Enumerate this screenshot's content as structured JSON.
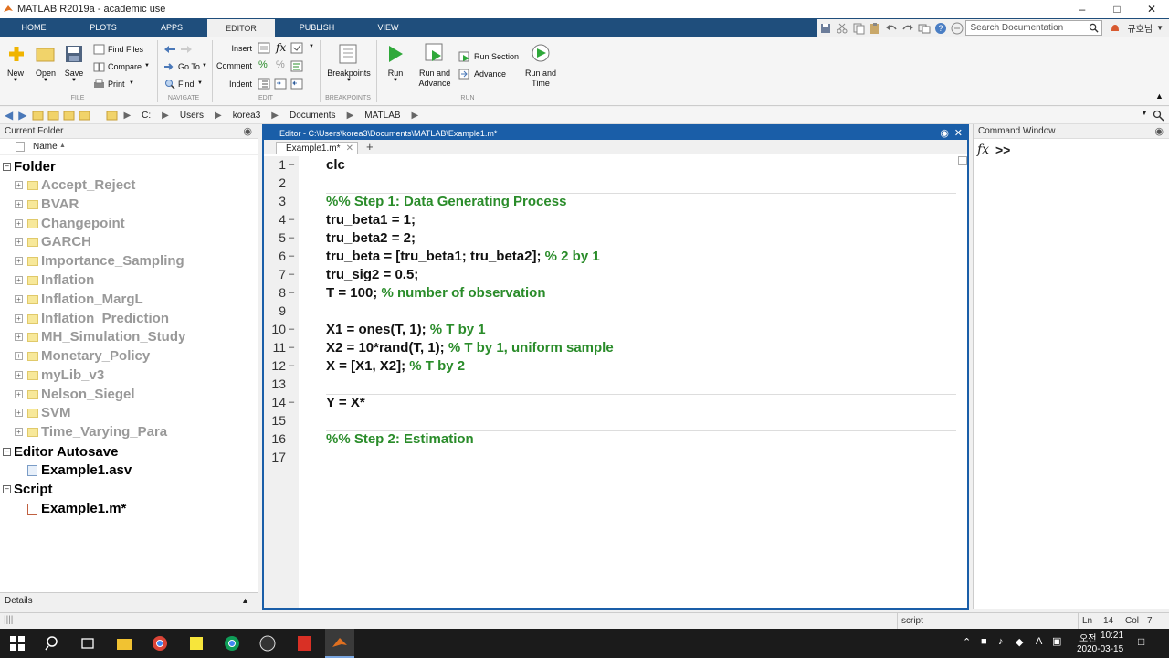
{
  "window": {
    "title": "MATLAB R2019a - academic use"
  },
  "tabs": [
    "HOME",
    "PLOTS",
    "APPS",
    "EDITOR",
    "PUBLISH",
    "VIEW"
  ],
  "active_tab": "EDITOR",
  "search": {
    "placeholder": "Search Documentation"
  },
  "user": {
    "name": "규호님"
  },
  "ribbon": {
    "new": "New",
    "open": "Open",
    "save": "Save",
    "find_files": "Find Files",
    "compare": "Compare",
    "print": "Print",
    "go_to": "Go To",
    "find": "Find",
    "insert": "Insert",
    "comment": "Comment",
    "indent": "Indent",
    "breakpoints": "Breakpoints",
    "run": "Run",
    "run_and_advance": "Run and Advance",
    "run_section": "Run Section",
    "advance": "Advance",
    "run_and_time": "Run and Time",
    "groups": {
      "file": "FILE",
      "navigate": "NAVIGATE",
      "edit": "EDIT",
      "breakpoints": "BREAKPOINTS",
      "run": "RUN"
    }
  },
  "address": {
    "path": [
      "C:",
      "Users",
      "korea3",
      "Documents",
      "MATLAB"
    ]
  },
  "current_folder": {
    "title": "Current Folder",
    "column": "Name",
    "sections": {
      "folder": "Folder",
      "autosave": "Editor Autosave",
      "script": "Script"
    },
    "folders": [
      "Accept_Reject",
      "BVAR",
      "Changepoint",
      "GARCH",
      "Importance_Sampling",
      "Inflation",
      "Inflation_MargL",
      "Inflation_Prediction",
      "MH_Simulation_Study",
      "Monetary_Policy",
      "myLib_v3",
      "Nelson_Siegel",
      "SVM",
      "Time_Varying_Para"
    ],
    "autosave_file": "Example1.asv",
    "script_file": "Example1.m*",
    "details": "Details"
  },
  "editor": {
    "header": "Editor - C:\\Users\\korea3\\Documents\\MATLAB\\Example1.m*",
    "tab": "Example1.m*",
    "lines": [
      {
        "n": "1",
        "dash": true,
        "code": "clc",
        "comment": ""
      },
      {
        "n": "2",
        "dash": false,
        "code": "",
        "comment": ""
      },
      {
        "n": "3",
        "dash": false,
        "code": "",
        "comment": "%% Step 1: Data Generating Process"
      },
      {
        "n": "4",
        "dash": true,
        "code": "tru_beta1 = 1;",
        "comment": ""
      },
      {
        "n": "5",
        "dash": true,
        "code": "tru_beta2 = 2;",
        "comment": ""
      },
      {
        "n": "6",
        "dash": true,
        "code": "tru_beta = [tru_beta1; tru_beta2]; ",
        "comment": "% 2 by 1"
      },
      {
        "n": "7",
        "dash": true,
        "code": "tru_sig2 = 0.5;",
        "comment": ""
      },
      {
        "n": "8",
        "dash": true,
        "code": "T = 100; ",
        "comment": "% number of observation"
      },
      {
        "n": "9",
        "dash": false,
        "code": "",
        "comment": ""
      },
      {
        "n": "10",
        "dash": true,
        "code": "X1 = ones(T, 1); ",
        "comment": "% T by 1"
      },
      {
        "n": "11",
        "dash": true,
        "code": "X2 = 10*rand(T, 1); ",
        "comment": "% T by 1, uniform sample"
      },
      {
        "n": "12",
        "dash": true,
        "code": "X = [X1, X2]; ",
        "comment": "% T by 2"
      },
      {
        "n": "13",
        "dash": false,
        "code": "",
        "comment": ""
      },
      {
        "n": "14",
        "dash": true,
        "code": "Y = X*",
        "comment": ""
      },
      {
        "n": "15",
        "dash": false,
        "code": "",
        "comment": ""
      },
      {
        "n": "16",
        "dash": false,
        "code": "",
        "comment": "%% Step 2: Estimation"
      },
      {
        "n": "17",
        "dash": false,
        "code": "",
        "comment": ""
      }
    ]
  },
  "command_window": {
    "title": "Command Window",
    "prompt": ">>"
  },
  "status": {
    "mode": "script",
    "ln_label": "Ln",
    "ln": "14",
    "col_label": "Col",
    "col": "7"
  },
  "clock": {
    "ampm": "오전",
    "time": "10:21",
    "date": "2020-03-15"
  }
}
